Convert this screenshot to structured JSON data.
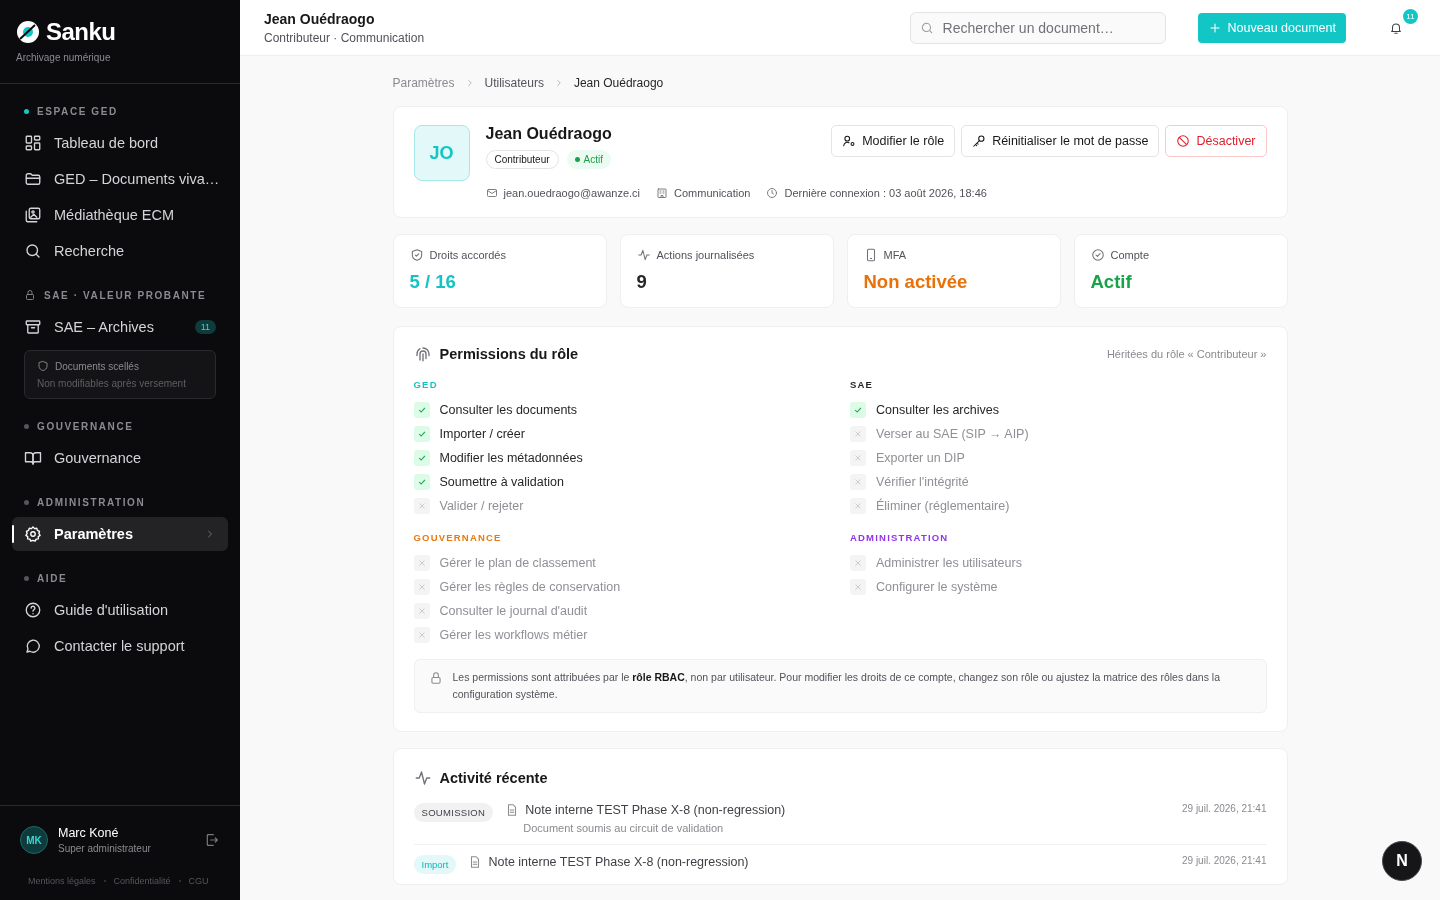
{
  "brand": {
    "name": "Sanku",
    "tagline": "Archivage numérique"
  },
  "sidebar": {
    "sections": [
      {
        "title": "ESPACE GED",
        "kind": "dot",
        "color": "#19c6c6",
        "items": [
          {
            "label": "Tableau de bord",
            "selected": false
          },
          {
            "label": "GED – Documents viva…",
            "selected": false
          },
          {
            "label": "Médiathèque ECM",
            "selected": false
          },
          {
            "label": "Recherche",
            "selected": false
          }
        ]
      },
      {
        "title": "SAE · VALEUR PROBANTE",
        "kind": "lock",
        "items": [
          {
            "label": "SAE – Archives",
            "selected": false,
            "badge": "11"
          }
        ],
        "notice": {
          "title": "Documents scellés",
          "text": "Non modifiables après versement"
        }
      },
      {
        "title": "GOUVERNANCE",
        "kind": "dot",
        "color": "#55555c",
        "items": [
          {
            "label": "Gouvernance",
            "selected": false
          }
        ]
      },
      {
        "title": "ADMINISTRATION",
        "kind": "dot",
        "color": "#55555c",
        "items": [
          {
            "label": "Paramètres",
            "selected": true
          }
        ]
      },
      {
        "title": "AIDE",
        "kind": "dot",
        "color": "#55555c",
        "items": [
          {
            "label": "Guide d'utilisation",
            "selected": false
          },
          {
            "label": "Contacter le support",
            "selected": false
          }
        ]
      }
    ],
    "user": {
      "initials": "MK",
      "name": "Marc Koné",
      "role": "Super administrateur"
    },
    "footer_links": [
      "Mentions légales",
      "Confidentialité",
      "CGU"
    ]
  },
  "header": {
    "title": "Jean Ouédraogo",
    "subtitle": "Contributeur · Communication",
    "search": {
      "placeholder": "Rechercher un document…"
    },
    "new_button": "Nouveau document",
    "notifications": "11"
  },
  "breadcrumb": [
    "Paramètres",
    "Utilisateurs",
    "Jean Ouédraogo"
  ],
  "profile": {
    "initials": "JO",
    "name": "Jean Ouédraogo",
    "role": "Contributeur",
    "status": "Actif",
    "email": "jean.ouedraogo@awanze.ci",
    "department": "Communication",
    "last_login": "Dernière connexion : 03 août 2026, 18:46",
    "actions": [
      {
        "label": "Modifier le rôle",
        "kind": "role"
      },
      {
        "label": "Réinitialiser le mot de passe",
        "kind": "key"
      },
      {
        "label": "Désactiver",
        "kind": "danger"
      }
    ]
  },
  "stats": [
    {
      "label": "Droits accordés",
      "value": "5 / 16",
      "color": "#14c4c4"
    },
    {
      "label": "Actions journalisées",
      "value": "9",
      "color": "#27272a"
    },
    {
      "label": "MFA",
      "value": "Non activée",
      "color": "#e8710a"
    },
    {
      "label": "Compte",
      "value": "Actif",
      "color": "#16a34a"
    }
  ],
  "permissions": {
    "title": "Permissions du rôle",
    "inherited": "Héritées du rôle « Contributeur »",
    "groups": [
      {
        "title": "GED",
        "color": "#14c4c4",
        "items": [
          {
            "label": "Consulter les documents",
            "granted": true
          },
          {
            "label": "Importer / créer",
            "granted": true
          },
          {
            "label": "Modifier les métadonnées",
            "granted": true
          },
          {
            "label": "Soumettre à validation",
            "granted": true
          },
          {
            "label": "Valider / rejeter",
            "granted": false
          }
        ]
      },
      {
        "title": "SAE",
        "color": "#27272a",
        "items": [
          {
            "label": "Consulter les archives",
            "granted": true
          },
          {
            "label": "Verser au SAE (SIP → AIP)",
            "granted": false
          },
          {
            "label": "Exporter un DIP",
            "granted": false
          },
          {
            "label": "Vérifier l'intégrité",
            "granted": false
          },
          {
            "label": "Éliminer (réglementaire)",
            "granted": false
          }
        ]
      },
      {
        "title": "GOUVERNANCE",
        "color": "#ea7a0c",
        "items": [
          {
            "label": "Gérer le plan de classement",
            "granted": false
          },
          {
            "label": "Gérer les règles de conservation",
            "granted": false
          },
          {
            "label": "Consulter le journal d'audit",
            "granted": false
          },
          {
            "label": "Gérer les workflows métier",
            "granted": false
          }
        ]
      },
      {
        "title": "ADMINISTRATION",
        "color": "#9333ea",
        "items": [
          {
            "label": "Administrer les utilisateurs",
            "granted": false
          },
          {
            "label": "Configurer le système",
            "granted": false
          }
        ]
      }
    ],
    "note": "Les permissions sont attribuées par le **rôle RBAC**, non par utilisateur. Pour modifier les droits de ce compte, changez son rôle ou ajustez la matrice des rôles dans la configuration système."
  },
  "activity": {
    "title": "Activité récente",
    "items": [
      {
        "tag": "SOUMISSION",
        "kind": "neutral",
        "title": "Note interne TEST Phase X-8 (non-regression)",
        "subtitle": "Document soumis au circuit de validation",
        "time": "29 juil. 2026, 21:41"
      },
      {
        "tag": "Import",
        "kind": "accent",
        "title": "Note interne TEST Phase X-8 (non-regression)",
        "time": "29 juil. 2026, 21:41"
      }
    ]
  },
  "dev_badge": "N"
}
